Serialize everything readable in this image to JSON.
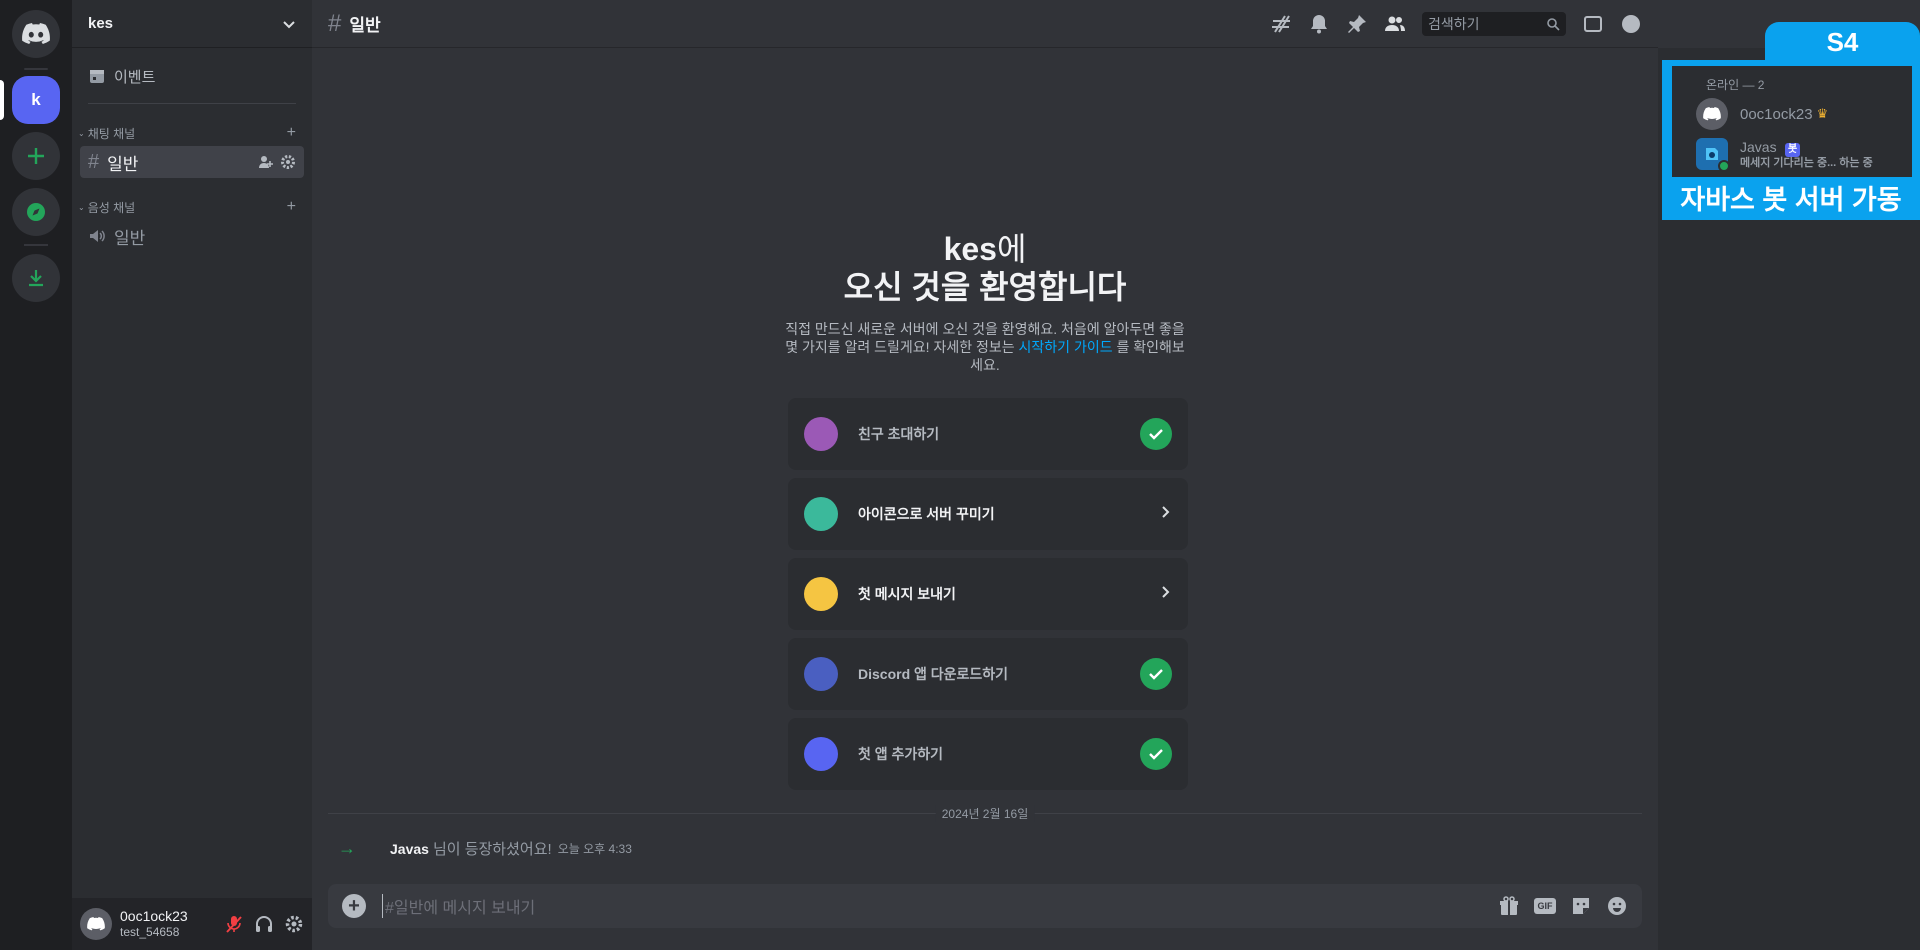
{
  "server": {
    "name": "kes",
    "initial": "k"
  },
  "sidebar": {
    "events_label": "이벤트",
    "text_category": "채팅 채널",
    "voice_category": "음성 채널",
    "text_channels": [
      {
        "name": "일반"
      }
    ],
    "voice_channels": [
      {
        "name": "일반"
      }
    ]
  },
  "user": {
    "name": "0oc1ock23",
    "tag": "test_54658"
  },
  "channel": {
    "name": "일반",
    "search_placeholder": "검색하기"
  },
  "welcome": {
    "server_name": "kes",
    "suffix": "에",
    "line2": "오신 것을 환영합니다",
    "desc_before": "직접 만드신 새로운 서버에 오신 것을 환영해요. 처음에 알아두면 좋을 몇 가지를 알려    드릴게요! 자세한 정보는",
    "desc_link": "시작하기 가이드",
    "desc_after": "를 확인해보세요."
  },
  "tasks": [
    {
      "label": "친구 초대하기",
      "done": true,
      "icon": "invite-icon",
      "color": "#9b59b6"
    },
    {
      "label": "아이콘으로 서버 꾸미기",
      "done": false,
      "icon": "paint-icon",
      "color": "#3bb99b"
    },
    {
      "label": "첫 메시지 보내기",
      "done": false,
      "icon": "message-icon",
      "color": "#f5c542"
    },
    {
      "label": "Discord 앱 다운로드하기",
      "done": true,
      "icon": "phone-icon",
      "color": "#4a5fc1"
    },
    {
      "label": "첫 앱 추가하기",
      "done": true,
      "icon": "app-icon",
      "color": "#5865f2"
    }
  ],
  "messages": {
    "date": "2024년 2월 16일",
    "join_user": "Javas",
    "join_text": "님이 등장하셨어요!",
    "join_time": "오늘 오후 4:33"
  },
  "composer": {
    "placeholder": "#일반에 메시지 보내기",
    "gif_label": "GIF"
  },
  "members": {
    "header": "온라인 — 2",
    "list": [
      {
        "name": "0oc1ock23",
        "owner": true
      },
      {
        "name": "Javas",
        "bot_label": "봇",
        "status": "메세지 기다리는 중... 하는 중"
      }
    ]
  },
  "overlay": {
    "tab": "S4",
    "caption": "자바스 봇 서버 가동"
  },
  "colors": {
    "blurple": "#5865f2",
    "green": "#23a55a",
    "overlay": "#0aa2ee"
  }
}
